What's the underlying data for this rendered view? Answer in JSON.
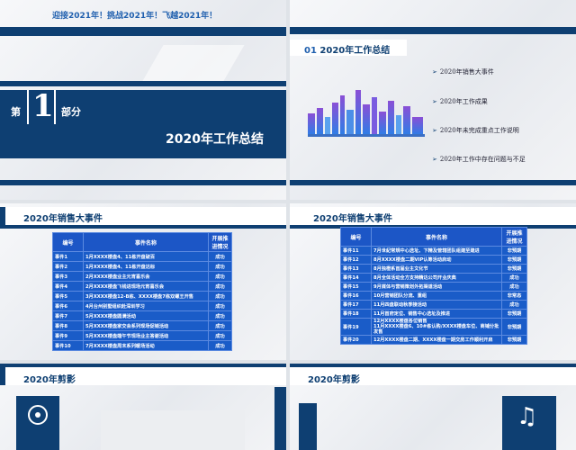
{
  "slide1": {
    "slogan": "迎接2021年！挑战2021年！飞越2021年！",
    "part_prefix": "第",
    "part_number": "1",
    "part_suffix": "部分",
    "title": "2020年工作总结"
  },
  "slide2": {
    "header_num": "01",
    "header_text": "2020年工作总结",
    "bullets": [
      "2020年销售大事件",
      "2020年工作成果",
      "2020年未完成重点工作说明",
      "2020年工作中存在问题与不足"
    ]
  },
  "slide3": {
    "header": "2020年销售大事件",
    "columns": [
      "编号",
      "事件名称",
      "开展推进情况"
    ],
    "rows": [
      [
        "事件1",
        "1月XXXX楼盘4、11栋开盘破百",
        "成功"
      ],
      [
        "事件2",
        "1月XXXX楼盘4、11栋开盘达标",
        "成功"
      ],
      [
        "事件3",
        "2月XXXX楼盘业主元宵喜乐会",
        "成功"
      ],
      [
        "事件4",
        "2月XXXX楼盘飞钱进现场元宵喜乐会",
        "成功"
      ],
      [
        "事件5",
        "3月XXXX楼盘12-B栋、XXXX楼盘7栋双螺王开售",
        "成功"
      ],
      [
        "事件6",
        "4月台州别墅组织赴深圳学习",
        "成功"
      ],
      [
        "事件7",
        "5月XXXX楼盘圆满活动",
        "成功"
      ],
      [
        "事件8",
        "5月XXXX楼盘家交会系列现场促销活动",
        "成功"
      ],
      [
        "事件9",
        "5月XXXX楼盘端午节现场业主答谢活动",
        "成功"
      ],
      [
        "事件10",
        "7月XXXX楼盘周末系列暖场活动",
        "成功"
      ]
    ]
  },
  "slide4": {
    "header": "2020年销售大事件",
    "columns": [
      "编号",
      "事件名称",
      "开展推进情况"
    ],
    "rows": [
      [
        "事件11",
        "7月世紀常規中心选址、下精及管辖团队组建至建进",
        "非预期"
      ],
      [
        "事件12",
        "8月XXXX楼盘二期VIP认筹活动启动",
        "非预期"
      ],
      [
        "事件13",
        "8月独橙系首届业主文化节",
        "非预期"
      ],
      [
        "事件14",
        "8月全体活动全方支持精达公司开业庆典",
        "成功"
      ],
      [
        "事件15",
        "9月媒体与营销策划外拓渠道活动",
        "成功"
      ],
      [
        "事件16",
        "10月营销团队分流、重组",
        "非常态"
      ],
      [
        "事件17",
        "11月四盘联动秋季接活动",
        "成功"
      ],
      [
        "事件18",
        "11月首府定位、销售中心选址及推进",
        "非预期"
      ],
      [
        "事件19",
        "12月XXXX楼盘各位销售\n11月XXXX楼盘6、10#栋认购/XXXX楼盘车位、商铺分批发售",
        "非预期"
      ],
      [
        "事件20",
        "12月XXXX楼盘二期、XXXX楼盘一期交房工作顺利开启",
        "非预期"
      ]
    ]
  },
  "slide5": {
    "header": "2020年剪影"
  },
  "slide6": {
    "header": "2020年剪影"
  },
  "colors": {
    "navy": "#0e3f72",
    "table_blue": "#1a5cc8",
    "accent_blue": "#1f5fae"
  },
  "icons": {
    "disc": "disc-icon",
    "music": "music-note-icon"
  }
}
